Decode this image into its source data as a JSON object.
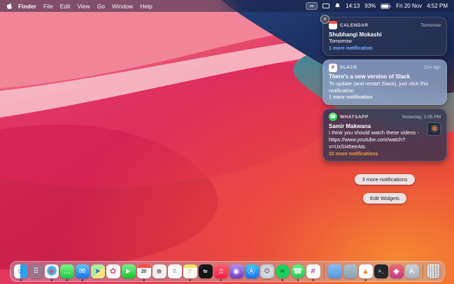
{
  "menu_bar": {
    "app_menus": [
      "Finder",
      "File",
      "Edit",
      "View",
      "Go",
      "Window",
      "Help"
    ],
    "status": {
      "loop_glyph": "∞",
      "timer": "14:13",
      "battery_percent": "93%",
      "date": "Fri 20 Nov",
      "time": "4:52 PM"
    }
  },
  "notification_center": {
    "close_glyph": "×",
    "cards": [
      {
        "app": "CALENDAR",
        "time": "Tomorrow",
        "title": "Shubhangi Mokashi",
        "body": "Tomorrow",
        "more": "1 more notification",
        "badge_glyph": "17"
      },
      {
        "app": "SLACK",
        "time": "11m ago",
        "title": "There's a new version of Slack",
        "body": "To update (and restart Slack), just click this notification",
        "more": "1 more notification",
        "badge_glyph": "#"
      },
      {
        "app": "WHATSAPP",
        "time": "Yesterday, 2:05 PM",
        "title": "Samir Makwana",
        "body": "I think you should watch these videos - https://www.youtube.com/watch?v=UxSI45eeAts",
        "more": "10 more notifications",
        "badge_glyph": "☎"
      }
    ],
    "more_notifications_label": "3 more notifications",
    "edit_widgets_label": "Edit Widgets"
  },
  "colors": {
    "calendar_link": "#6fb0ff",
    "slack_link": "#eef2f8",
    "whatsapp_link": "#f0a43c",
    "calendar_red": "#ff4e44",
    "whatsapp_green": "#25d366",
    "slack_aubergine": "#7c2d8e",
    "menubar_tint": "rgba(24,30,62,0.52)"
  },
  "dock": {
    "items": [
      {
        "name": "finder",
        "glyph": "☺",
        "bg": "linear-gradient(90deg,#ffffff 0 46%,#29a3e9 46% 100%)",
        "fg": "#1767c4",
        "running": true
      },
      {
        "name": "launchpad",
        "glyph": "⠿",
        "bg": "rgba(120,126,142,0.6)",
        "fg": "#ffffff"
      },
      {
        "name": "safari",
        "glyph": "◈",
        "bg": "radial-gradient(circle at 50% 45%,#4ab3f4 0 45%,#f4f6f8 47%)",
        "fg": "#e84d3d",
        "running": true
      },
      {
        "name": "messages",
        "glyph": "…",
        "bg": "linear-gradient(#7df58a,#17c93c)",
        "fg": "#ffffff",
        "running": true
      },
      {
        "name": "mail",
        "glyph": "✉",
        "bg": "linear-gradient(#5ac8f8,#1a73e8)",
        "fg": "#ffffff",
        "running": true
      },
      {
        "name": "maps",
        "glyph": "➤",
        "bg": "linear-gradient(135deg,#aeeb9e 0 55%,#f7e67e 55% 100%)",
        "fg": "#2e6fd2"
      },
      {
        "name": "photos",
        "glyph": "✿",
        "bg": "#fcfcfc",
        "fg": "#e8447a"
      },
      {
        "name": "facetime",
        "glyph": "►",
        "bg": "linear-gradient(#7df08c,#12c32e)",
        "fg": "#ffffff"
      },
      {
        "name": "calendar",
        "glyph": "20",
        "bg": "linear-gradient(#ff4e44 0 26%,#fcfcfc 26%)",
        "fg": "#3a3a3c",
        "running": true
      },
      {
        "name": "contacts",
        "glyph": "☻",
        "bg": "#f5f2ee",
        "fg": "#8a8784"
      },
      {
        "name": "reminders",
        "glyph": "≡",
        "bg": "#fcfcfc",
        "fg": "#9aa2ab"
      },
      {
        "name": "notes",
        "glyph": "≡",
        "bg": "linear-gradient(#f8e26a 0 24%,#fdfbf3 24%)",
        "fg": "#cfc9b2",
        "running": true
      },
      {
        "name": "tv",
        "glyph": "tv",
        "bg": "#141518",
        "fg": "#ffffff"
      },
      {
        "name": "music",
        "glyph": "♫",
        "bg": "linear-gradient(#fc5f74,#f81e3d)",
        "fg": "#ffffff",
        "running": true
      },
      {
        "name": "podcasts",
        "glyph": "◉",
        "bg": "linear-gradient(#b18df2,#6f3ac4)",
        "fg": "#ffffff"
      },
      {
        "name": "app-store",
        "glyph": "Ⓐ",
        "bg": "linear-gradient(#34c3f4,#1c70ed)",
        "fg": "#ffffff"
      },
      {
        "name": "system-preferences",
        "glyph": "⚙",
        "bg": "radial-gradient(#ededf1,#b6bac3)",
        "fg": "#686c74"
      },
      {
        "name": "spotify",
        "glyph": "≈",
        "bg": "#17d05c",
        "fg": "#0c2417",
        "round": true,
        "running": true
      },
      {
        "name": "whatsapp",
        "glyph": "☎",
        "bg": "linear-gradient(#5ef877,#1fcc59)",
        "fg": "#ffffff",
        "round": true,
        "running": true
      },
      {
        "name": "slack",
        "glyph": "#",
        "bg": "#fcfcfc",
        "fg": "#7c2d8e",
        "running": true
      },
      {
        "type": "separator"
      },
      {
        "name": "folder-documents",
        "glyph": "",
        "bg": "linear-gradient(#82bdf4,#5b97e0)"
      },
      {
        "name": "folder-downloads",
        "glyph": "",
        "bg": "linear-gradient(#aebfcd,#8aa0b4)"
      },
      {
        "name": "vlc",
        "glyph": "▲",
        "bg": "#fcfcfc",
        "fg": "#ff8a1e",
        "running": true
      },
      {
        "name": "terminal",
        "glyph": ">_",
        "bg": "#24262c",
        "fg": "#d8ffd8"
      },
      {
        "name": "media-app",
        "glyph": "◆",
        "bg": "linear-gradient(#ef6a6d,#bf3a90)",
        "fg": "#ffffff"
      },
      {
        "name": "folder-applications",
        "glyph": "A",
        "bg": "linear-gradient(#c9cfd8,#a7afbb)",
        "fg": "#ffffff"
      },
      {
        "type": "separator"
      },
      {
        "name": "trash",
        "glyph": "",
        "trash": true
      }
    ]
  }
}
